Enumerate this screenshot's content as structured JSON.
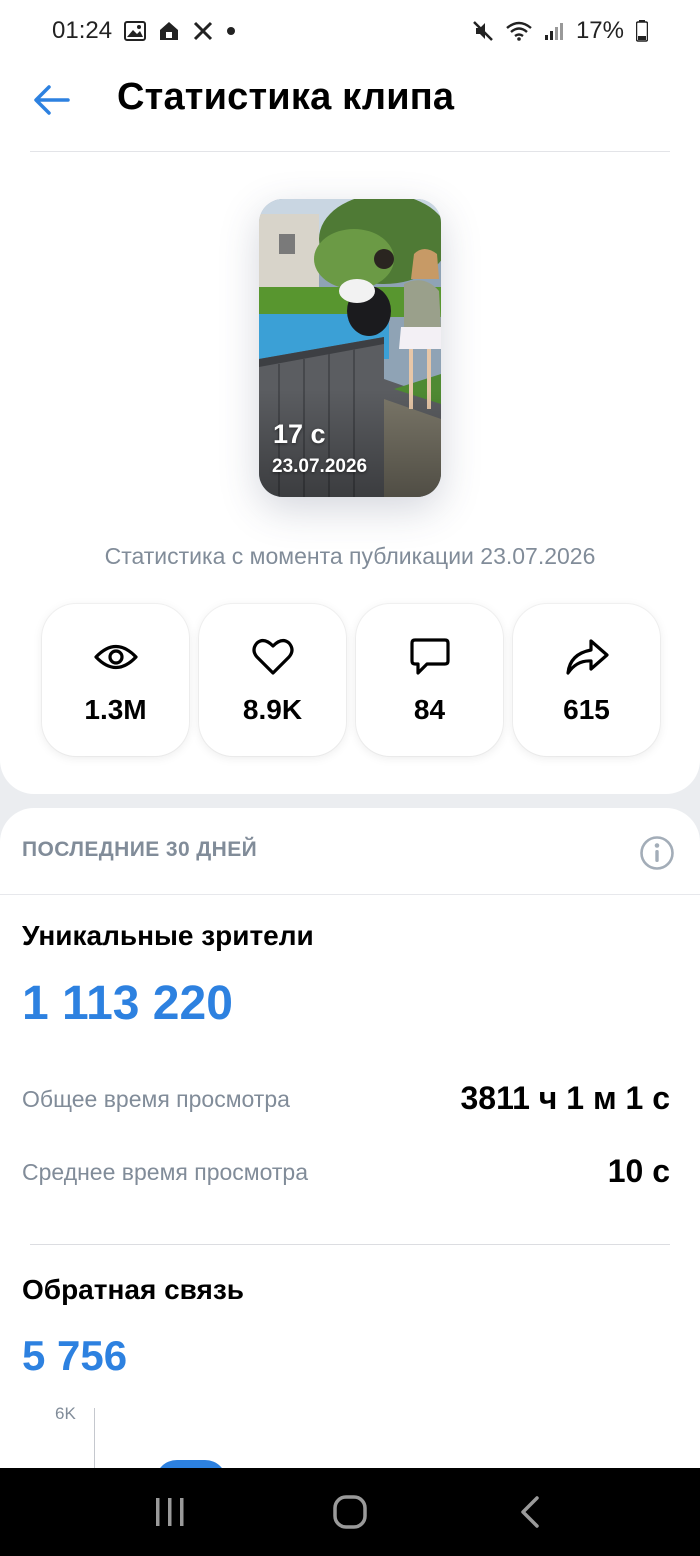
{
  "status_bar": {
    "time": "01:24",
    "left_icons": [
      "image-icon",
      "home-lock-icon",
      "x-logo-icon",
      "dot-icon"
    ],
    "right_icons": [
      "mute-icon",
      "wifi-icon",
      "signal-icon",
      "battery-icon"
    ],
    "battery": "17%"
  },
  "header": {
    "title": "Статистика клипа",
    "back_icon": "arrow-left-icon"
  },
  "clip": {
    "duration": "17 с",
    "date": "23.07.2026"
  },
  "since_text": "Статистика с момента публикации 23.07.2026",
  "stats": [
    {
      "icon": "eye-icon",
      "value": "1.3M"
    },
    {
      "icon": "heart-icon",
      "value": "8.9K"
    },
    {
      "icon": "comment-icon",
      "value": "84"
    },
    {
      "icon": "share-icon",
      "value": "615"
    }
  ],
  "period": {
    "label": "ПОСЛЕДНИЕ 30 ДНЕЙ",
    "info_icon": "info-icon"
  },
  "unique_viewers": {
    "title": "Уникальные зрители",
    "value": "1 113 220"
  },
  "watch_time": {
    "total_label": "Общее время просмотра",
    "total_value": "3811 ч 1 м 1 с",
    "avg_label": "Среднее время просмотра",
    "avg_value": "10 с"
  },
  "feedback": {
    "title": "Обратная связь",
    "value": "5 756",
    "chart_tick": "6K"
  },
  "colors": {
    "accent": "#2d81e0",
    "secondary_text": "#818c99",
    "background": "#ebedf0"
  },
  "nav": [
    "recents-icon",
    "home-icon",
    "back-icon"
  ]
}
